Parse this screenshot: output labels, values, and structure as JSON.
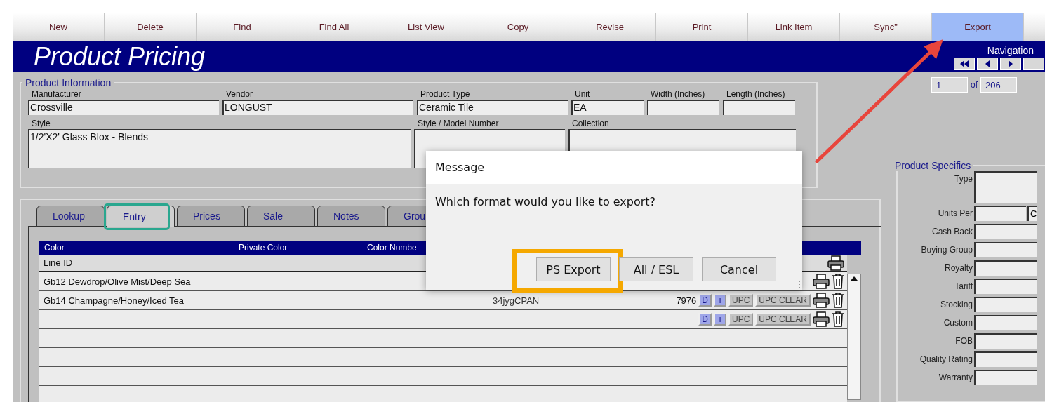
{
  "toolbar": [
    {
      "label": "New",
      "selected": false
    },
    {
      "label": "Delete",
      "selected": false
    },
    {
      "label": "Find",
      "selected": false
    },
    {
      "label": "Find All",
      "selected": false
    },
    {
      "label": "List View",
      "selected": false
    },
    {
      "label": "Copy",
      "selected": false
    },
    {
      "label": "Revise",
      "selected": false
    },
    {
      "label": "Print",
      "selected": false
    },
    {
      "label": "Link Item",
      "selected": false
    },
    {
      "label": "Sync\"",
      "selected": false
    },
    {
      "label": "Export",
      "selected": true
    }
  ],
  "annotations": [
    {
      "kind": "arrow"
    }
  ],
  "title": "Product Pricing",
  "navigation": {
    "label": "Navigation",
    "record": "1",
    "of": "of",
    "total": "206"
  },
  "product_information": {
    "legend": "Product Information",
    "fields": [
      {
        "label": "Manufacturer",
        "value": "Crossville",
        "kind": "wide"
      },
      {
        "label": "Vendor",
        "value": "LONGUST",
        "kind": "wide"
      },
      {
        "label": "Product Type",
        "value": "Ceramic Tile",
        "kind": "medium"
      },
      {
        "label": "Unit",
        "value": "EA",
        "kind": "small"
      },
      {
        "label": "Width (Inches)",
        "kind": "small"
      },
      {
        "label": "Length (Inches)",
        "kind": "small"
      },
      {
        "label": "Style",
        "value": "1/2'X2' Glass Blox - Blends",
        "kind": "style"
      },
      {
        "label": "Style / Model Number",
        "kind": "medium_tall"
      },
      {
        "label": "Collection",
        "kind": "large_tall"
      }
    ]
  },
  "tabs": [
    {
      "label": "Lookup",
      "selected": false,
      "highlighted": false
    },
    {
      "label": "Entry",
      "selected": true,
      "highlighted": true
    },
    {
      "label": "Prices",
      "selected": false,
      "highlighted": false
    },
    {
      "label": "Sale",
      "selected": false,
      "highlighted": false
    },
    {
      "label": "Notes",
      "selected": false,
      "highlighted": false
    },
    {
      "label": "Grou",
      "selected": false,
      "highlighted": false
    }
  ],
  "table": {
    "columns": [
      "Color",
      "Private Color",
      "Color Numbe"
    ],
    "rows": [
      {
        "kind": "subheader",
        "text": "Line ID",
        "actions": [
          {
            "kind": "print"
          }
        ]
      },
      {
        "kind": "row",
        "text": "Gb12 Dewdrop/Olive Mist/Deep Sea",
        "actions": [
          {
            "kind": "print"
          },
          {
            "kind": "trash"
          }
        ]
      },
      {
        "kind": "row",
        "text": "Gb14 Champagne/Honey/Iced Tea",
        "code": "34jygCPAN",
        "number": "7976",
        "actions": [
          {
            "kind": "d",
            "label": "D"
          },
          {
            "kind": "i",
            "label": "i"
          },
          {
            "kind": "upc",
            "label": "UPC"
          },
          {
            "kind": "upc",
            "label": "UPC CLEAR"
          },
          {
            "kind": "print"
          },
          {
            "kind": "trash"
          }
        ]
      },
      {
        "kind": "row",
        "actions": [
          {
            "kind": "d",
            "label": "D"
          },
          {
            "kind": "i",
            "label": "i"
          },
          {
            "kind": "upc",
            "label": "UPC"
          },
          {
            "kind": "upc",
            "label": "UPC CLEAR"
          },
          {
            "kind": "print"
          },
          {
            "kind": "trash"
          }
        ]
      },
      {
        "kind": "row",
        "actions": []
      },
      {
        "kind": "row",
        "actions": []
      },
      {
        "kind": "row",
        "actions": []
      },
      {
        "kind": "row",
        "actions": []
      }
    ]
  },
  "product_specifics": {
    "legend": "Product Specifics",
    "fields": [
      {
        "label": "Type",
        "kind": "tall"
      },
      {
        "label": "Units Per",
        "kind": "pair",
        "value_2": "C"
      },
      {
        "label": "Cash Back",
        "kind": "single"
      },
      {
        "label": "Buying Group",
        "kind": "single"
      },
      {
        "label": "Royalty",
        "kind": "single"
      },
      {
        "label": "Tariff",
        "kind": "single"
      },
      {
        "label": "Stocking",
        "kind": "single"
      },
      {
        "label": "Custom",
        "kind": "single"
      },
      {
        "label": "FOB",
        "kind": "single"
      },
      {
        "label": "Quality Rating",
        "kind": "single"
      },
      {
        "label": "Warranty",
        "kind": "single"
      }
    ]
  },
  "dialog": {
    "title": "Message",
    "message": "Which format would you like to export?",
    "buttons": [
      {
        "label": "PS Export",
        "highlighted": true
      },
      {
        "label": "All / ESL",
        "highlighted": false
      },
      {
        "label": "Cancel",
        "highlighted": false
      }
    ]
  }
}
